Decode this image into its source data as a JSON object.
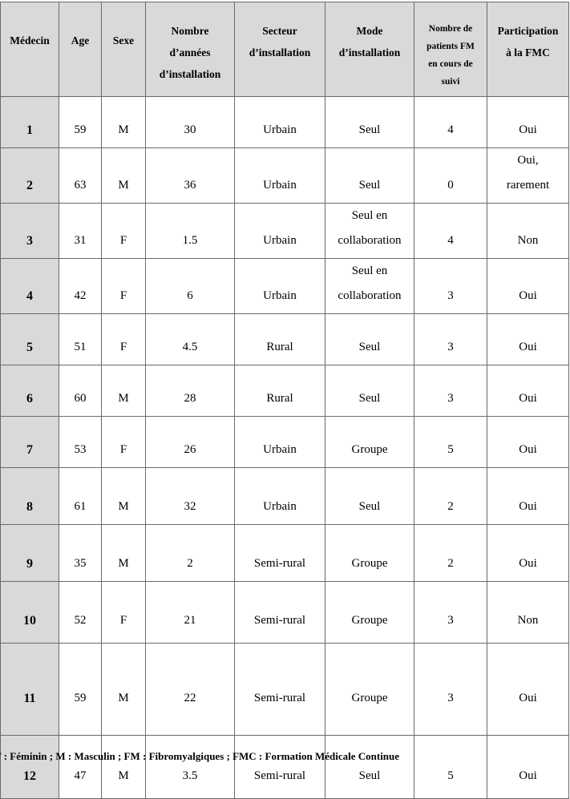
{
  "table": {
    "headers": [
      "Médecin",
      "Age",
      "Sexe",
      "Nombre d’années d’installation",
      "Secteur d’installation",
      "Mode d’installation",
      "Nombre de patients FM en cours de suivi",
      "Participation à la FMC"
    ],
    "header_lines": {
      "nombre_annees": [
        "Nombre",
        "d’années",
        "d’installation"
      ],
      "secteur": [
        "Secteur",
        "d’installation"
      ],
      "mode": [
        "Mode",
        "d’installation"
      ],
      "patients": [
        "Nombre de",
        "patients FM",
        "en cours de",
        "suivi"
      ],
      "participation": [
        "Participation",
        "à la FMC"
      ]
    },
    "rows": [
      {
        "medecin": "1",
        "age": "59",
        "sexe": "M",
        "annees": "30",
        "secteur": "Urbain",
        "mode": "Seul",
        "patients": "4",
        "fmc": "Oui"
      },
      {
        "medecin": "2",
        "age": "63",
        "sexe": "M",
        "annees": "36",
        "secteur": "Urbain",
        "mode": "Seul",
        "patients": "0",
        "fmc": "Oui, rarement"
      },
      {
        "medecin": "3",
        "age": "31",
        "sexe": "F",
        "annees": "1.5",
        "secteur": "Urbain",
        "mode": "Seul en collaboration",
        "patients": "4",
        "fmc": "Non"
      },
      {
        "medecin": "4",
        "age": "42",
        "sexe": "F",
        "annees": "6",
        "secteur": "Urbain",
        "mode": "Seul en collaboration",
        "patients": "3",
        "fmc": "Oui"
      },
      {
        "medecin": "5",
        "age": "51",
        "sexe": "F",
        "annees": "4.5",
        "secteur": "Rural",
        "mode": "Seul",
        "patients": "3",
        "fmc": "Oui"
      },
      {
        "medecin": "6",
        "age": "60",
        "sexe": "M",
        "annees": "28",
        "secteur": "Rural",
        "mode": "Seul",
        "patients": "3",
        "fmc": "Oui"
      },
      {
        "medecin": "7",
        "age": "53",
        "sexe": "F",
        "annees": "26",
        "secteur": "Urbain",
        "mode": "Groupe",
        "patients": "5",
        "fmc": "Oui"
      },
      {
        "medecin": "8",
        "age": "61",
        "sexe": "M",
        "annees": "32",
        "secteur": "Urbain",
        "mode": "Seul",
        "patients": "2",
        "fmc": "Oui"
      },
      {
        "medecin": "9",
        "age": "35",
        "sexe": "M",
        "annees": "2",
        "secteur": "Semi-rural",
        "mode": "Groupe",
        "patients": "2",
        "fmc": "Oui"
      },
      {
        "medecin": "10",
        "age": "52",
        "sexe": "F",
        "annees": "21",
        "secteur": "Semi-rural",
        "mode": "Groupe",
        "patients": "3",
        "fmc": "Non"
      },
      {
        "medecin": "11",
        "age": "59",
        "sexe": "M",
        "annees": "22",
        "secteur": "Semi-rural",
        "mode": "Groupe",
        "patients": "3",
        "fmc": "Oui"
      },
      {
        "medecin": "12",
        "age": "47",
        "sexe": "M",
        "annees": "3.5",
        "secteur": "Semi-rural",
        "mode": "Seul",
        "patients": "5",
        "fmc": "Oui"
      }
    ]
  },
  "footer": {
    "legend": "F : Féminin ; M : Masculin ; FM : Fibromyalgiques ; FMC : Formation Médicale Continue"
  },
  "colors": {
    "header_bg": "#d9d9d9",
    "id_col_bg": "#d9d9d9",
    "border": "#6a6a6a"
  }
}
